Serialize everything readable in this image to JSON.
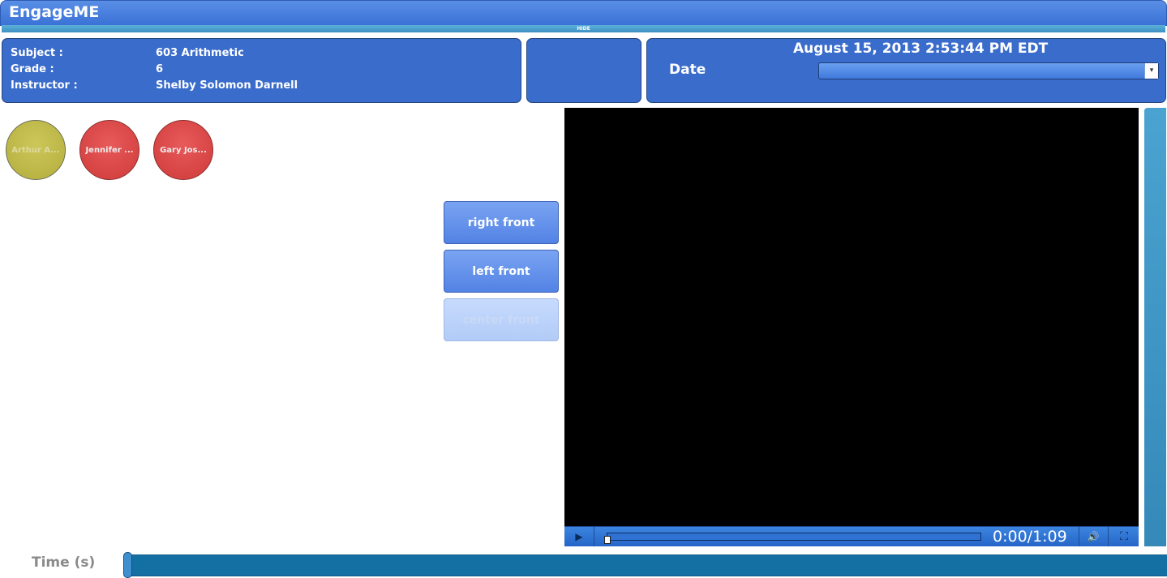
{
  "app": {
    "title": "EngageME",
    "hide_label": "HIDE"
  },
  "info": {
    "subject_label": "Subject :",
    "subject_value": "603 Arithmetic",
    "grade_label": "Grade :",
    "grade_value": "6",
    "instructor_label": "Instructor :",
    "instructor_value": "Shelby Solomon Darnell"
  },
  "date_panel": {
    "current": "August 15, 2013 2:53:44 PM EDT",
    "label": "Date",
    "selected": "",
    "arrow_icon": "▾"
  },
  "students": [
    {
      "name": "Arthur A...",
      "color": "#c2bd4c"
    },
    {
      "name": "Jennifer ...",
      "color": "#dd4747"
    },
    {
      "name": "Gary Jos...",
      "color": "#dd4747"
    }
  ],
  "camera_buttons": {
    "right_front": "right front",
    "left_front": "left front",
    "third": "center front"
  },
  "video": {
    "play_icon": "▶",
    "time": "0:00/1:09",
    "volume_icon": "🔊",
    "fullscreen_icon": "⛶",
    "progress": 0
  },
  "timeline": {
    "label": "Time (s)",
    "position": 0
  }
}
